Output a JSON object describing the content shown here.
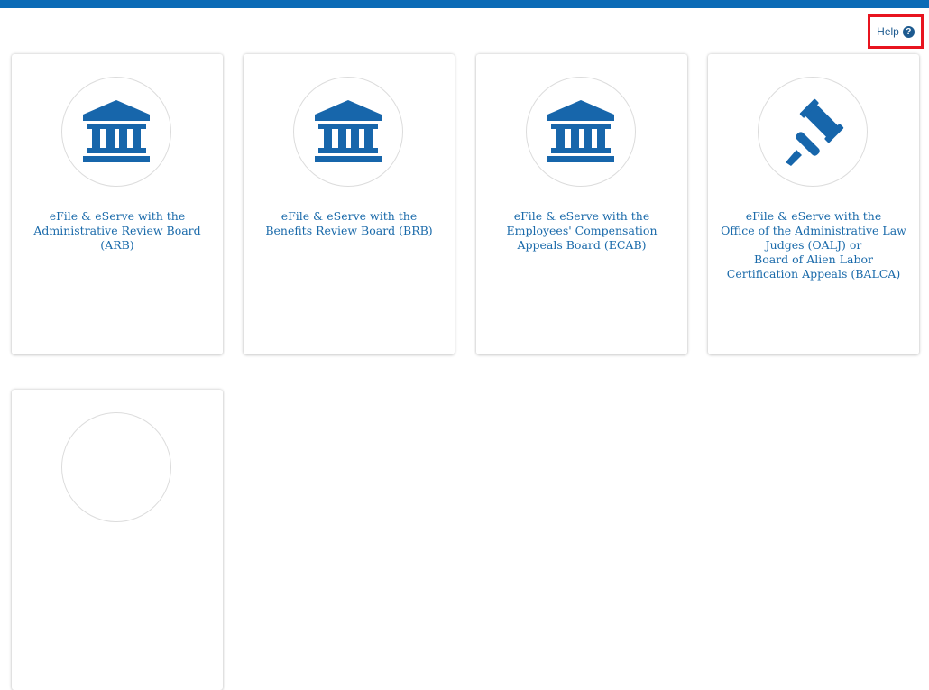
{
  "colors": {
    "accent": "#0b6bb6",
    "link": "#1a6aaa",
    "icon": "#1766ab",
    "highlight": "#e8141f"
  },
  "header": {
    "help_label": "Help",
    "help_icon": "question-circle-icon"
  },
  "cards": [
    {
      "icon": "courthouse-icon",
      "lines": [
        "eFile & eServe with the",
        "Administrative Review Board",
        "(ARB)"
      ]
    },
    {
      "icon": "courthouse-icon",
      "lines": [
        "eFile & eServe with the",
        "Benefits Review Board (BRB)"
      ]
    },
    {
      "icon": "courthouse-icon",
      "lines": [
        "eFile & eServe with the",
        "Employees' Compensation",
        "Appeals Board (ECAB)"
      ]
    },
    {
      "icon": "gavel-icon",
      "lines": [
        "eFile & eServe with the",
        "Office of the Administrative Law",
        "Judges (OALJ) or",
        "Board of Alien Labor",
        "Certification Appeals (BALCA)"
      ]
    },
    {
      "icon": "partial-card-icon",
      "lines": []
    }
  ]
}
